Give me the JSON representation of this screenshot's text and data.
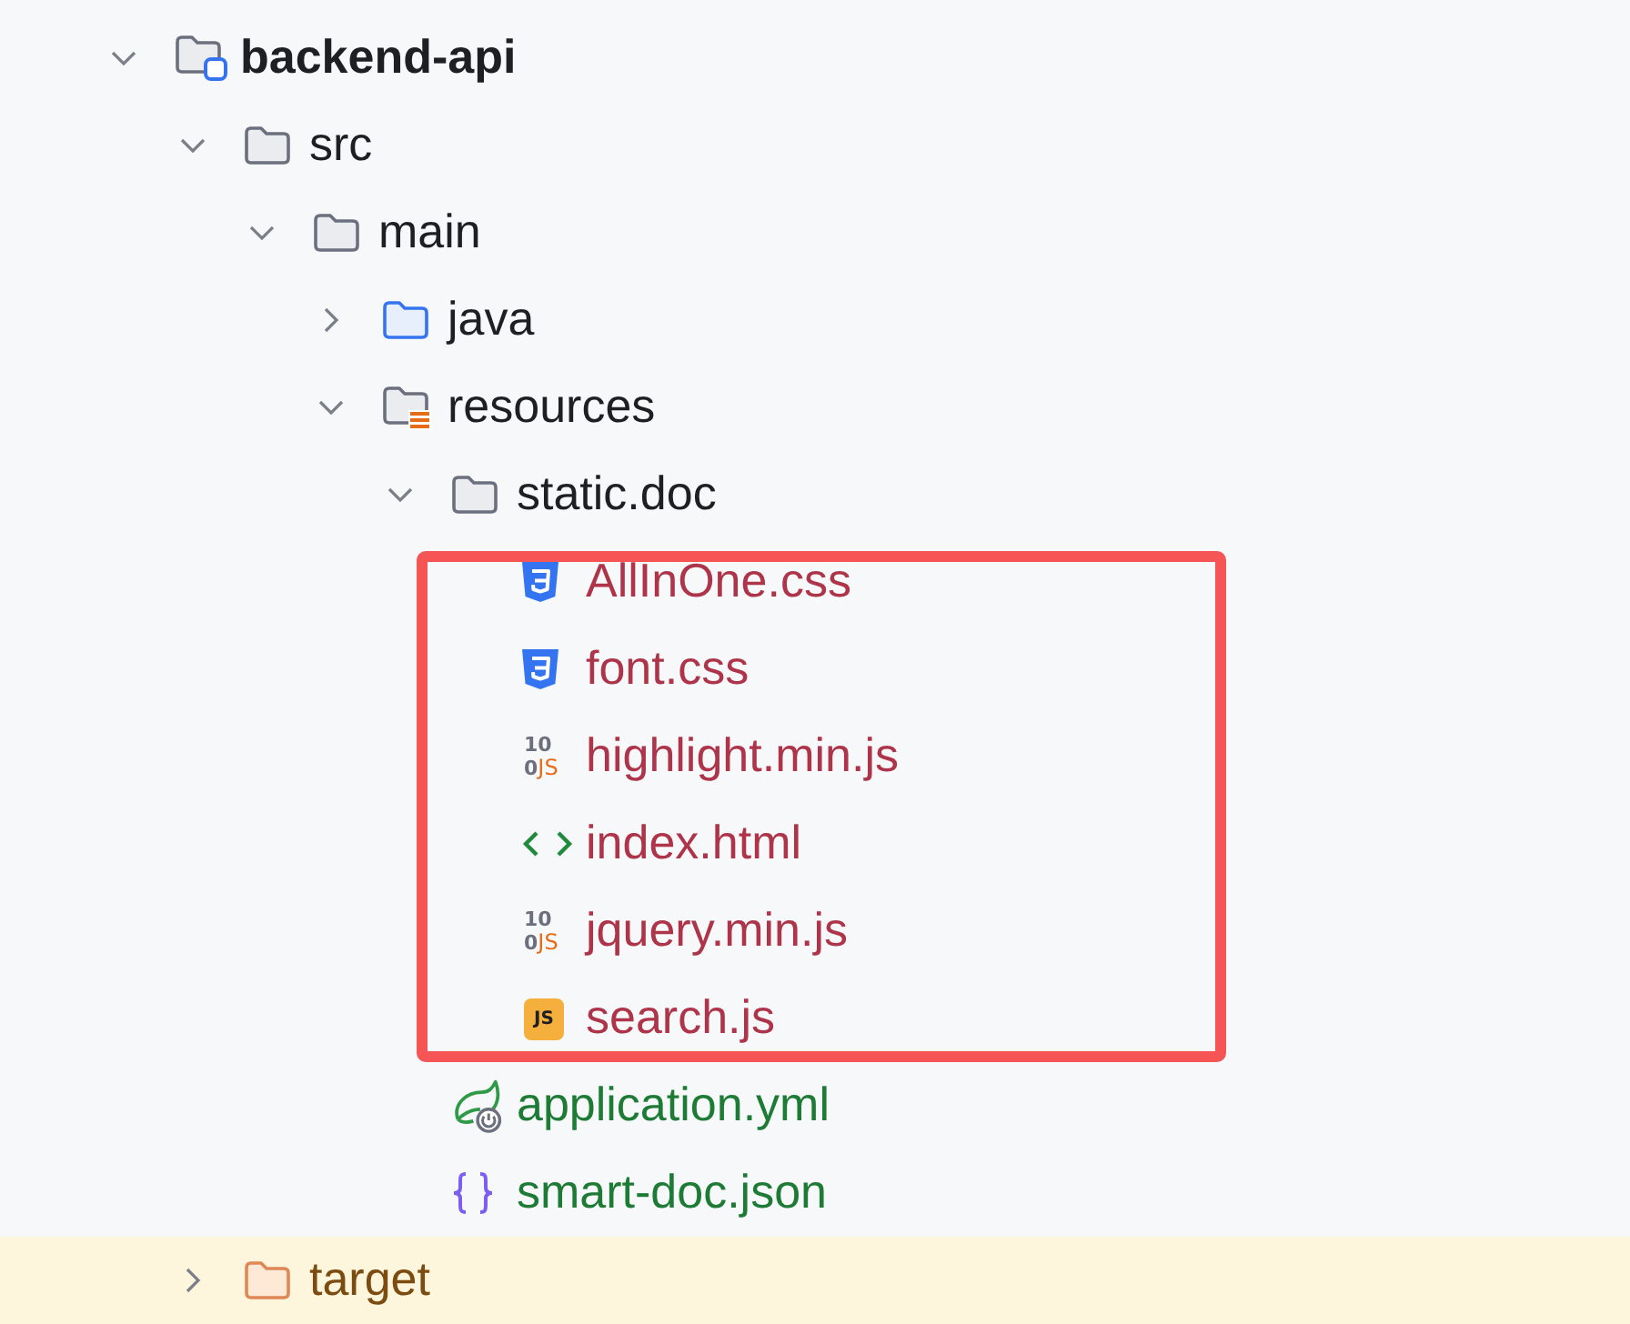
{
  "tree": [
    {
      "name": "backend-api",
      "kind": "module",
      "color": "#1e1f22",
      "expanded": true,
      "children": [
        {
          "name": "src",
          "kind": "folder",
          "color": "#1e1f22",
          "expanded": true,
          "children": [
            {
              "name": "main",
              "kind": "folder",
              "color": "#1e1f22",
              "expanded": true,
              "children": [
                {
                  "name": "java",
                  "kind": "source-folder",
                  "color": "#1e1f22",
                  "expanded": false
                },
                {
                  "name": "resources",
                  "kind": "resource-folder",
                  "color": "#1e1f22",
                  "expanded": true,
                  "children": [
                    {
                      "name": "static.doc",
                      "kind": "folder",
                      "color": "#1e1f22",
                      "expanded": true,
                      "framed": true,
                      "children": [
                        {
                          "name": "AllInOne.css",
                          "kind": "css",
                          "color": "#ae3449"
                        },
                        {
                          "name": "font.css",
                          "kind": "css",
                          "color": "#ae3449"
                        },
                        {
                          "name": "highlight.min.js",
                          "kind": "min-js",
                          "color": "#ae3449",
                          "badge": [
                            "10",
                            "0",
                            "JS"
                          ]
                        },
                        {
                          "name": "index.html",
                          "kind": "html",
                          "color": "#ae3449"
                        },
                        {
                          "name": "jquery.min.js",
                          "kind": "min-js",
                          "color": "#ae3449",
                          "badge": [
                            "10",
                            "0",
                            "JS"
                          ]
                        },
                        {
                          "name": "search.js",
                          "kind": "js",
                          "color": "#ae3449",
                          "badge": [
                            "JS"
                          ]
                        }
                      ]
                    },
                    {
                      "name": "application.yml",
                      "kind": "spring-config",
                      "color": "#1d7b35"
                    },
                    {
                      "name": "smart-doc.json",
                      "kind": "json",
                      "color": "#1d7b35"
                    }
                  ]
                }
              ]
            }
          ]
        },
        {
          "name": "target",
          "kind": "excluded-folder",
          "color": "#7b4b10",
          "expanded": false
        }
      ]
    }
  ]
}
